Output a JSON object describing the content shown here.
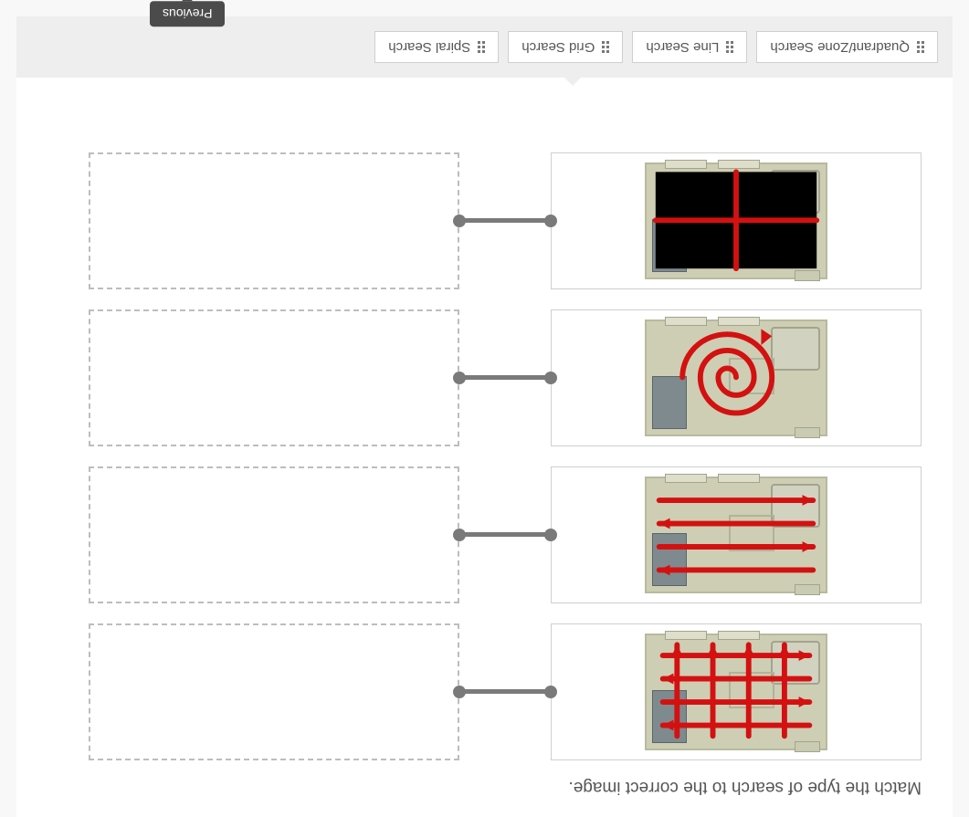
{
  "prompt": "Match the type of search to the correct image.",
  "images": [
    {
      "pattern": "grid"
    },
    {
      "pattern": "line"
    },
    {
      "pattern": "spiral"
    },
    {
      "pattern": "quadrant"
    }
  ],
  "tokens": [
    "Quadrant/Zone Search",
    "Line Search",
    "Grid Search",
    "Spiral Search"
  ],
  "nav": {
    "previous": "Previous"
  },
  "colors": {
    "overlay": "#d31111",
    "tray": "#eeeeee",
    "border": "#cfcfcf"
  }
}
